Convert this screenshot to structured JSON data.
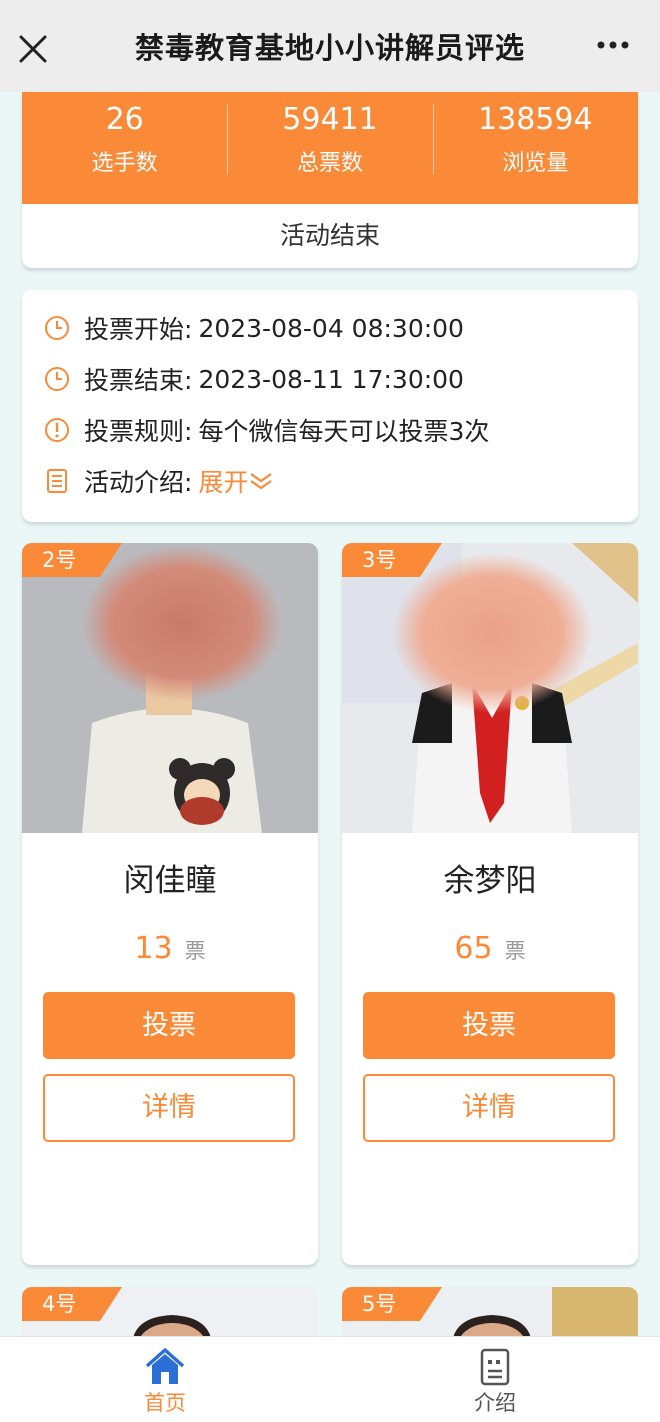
{
  "header": {
    "title": "禁毒教育基地小小讲解员评选"
  },
  "stats": [
    {
      "value": "26",
      "label": "选手数"
    },
    {
      "value": "59411",
      "label": "总票数"
    },
    {
      "value": "138594",
      "label": "浏览量"
    }
  ],
  "status": "活动结束",
  "info": {
    "start_label": "投票开始:",
    "start_value": "2023-08-04 08:30:00",
    "end_label": "投票结束:",
    "end_value": "2023-08-11 17:30:00",
    "rule_label": "投票规则:",
    "rule_value": "每个微信每天可以投票3次",
    "intro_label": "活动介绍:",
    "intro_expand": "展开"
  },
  "contestants": [
    {
      "badge": "2号",
      "name": "闵佳瞳",
      "votes": "13",
      "unit": "票",
      "vote_label": "投票",
      "detail_label": "详情"
    },
    {
      "badge": "3号",
      "name": "余梦阳",
      "votes": "65",
      "unit": "票",
      "vote_label": "投票",
      "detail_label": "详情"
    },
    {
      "badge": "4号"
    },
    {
      "badge": "5号"
    }
  ],
  "nav": {
    "home": "首页",
    "intro": "介绍"
  },
  "colors": {
    "accent": "#fa8a38",
    "background": "#eaf7f6"
  },
  "icons": [
    "close-icon",
    "more-icon",
    "clock-icon",
    "info-icon",
    "document-icon",
    "chevron-double-down-icon",
    "home-icon",
    "intro-icon"
  ]
}
